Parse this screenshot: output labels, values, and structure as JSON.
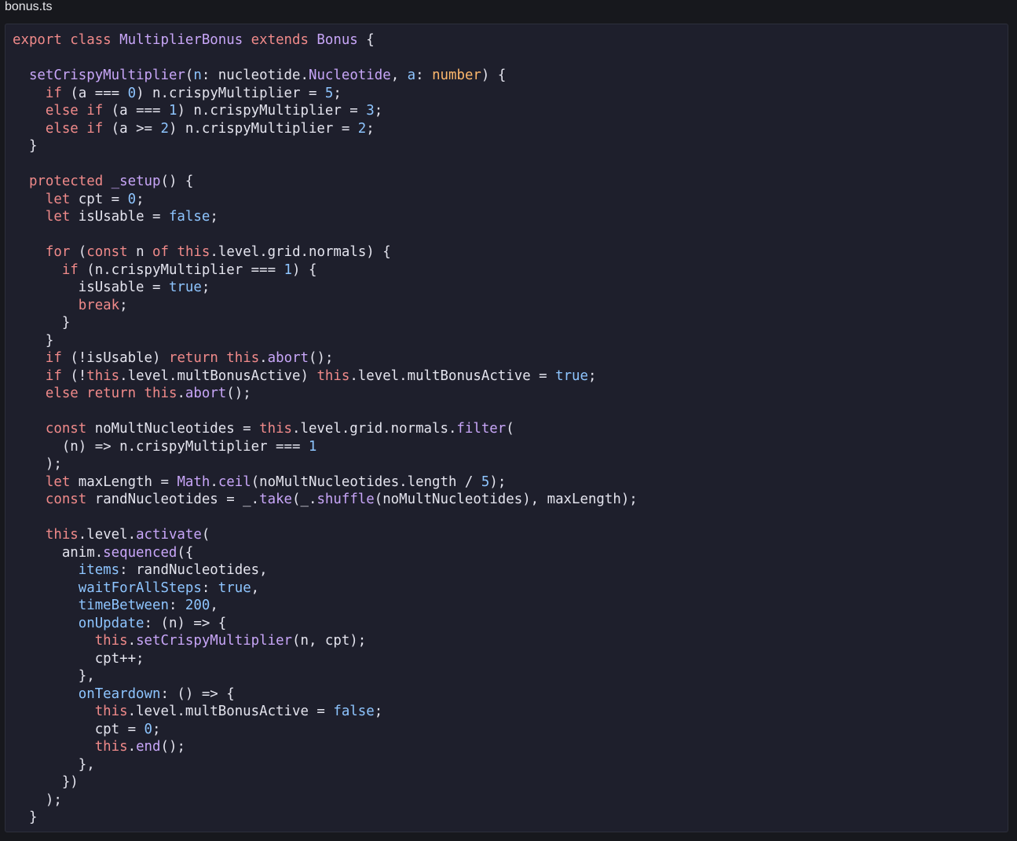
{
  "file_tab": {
    "title": "bonus.ts"
  },
  "colors": {
    "keyword": "#f08a8a",
    "function": "#c8a6f8",
    "property": "#8ec5ff",
    "type": "#ffb86c",
    "text": "#e4e4ee",
    "background": "#1e1f2c"
  },
  "code_lines": [
    [
      [
        "k",
        "export class "
      ],
      [
        "f",
        "MultiplierBonus"
      ],
      [
        "k",
        " extends "
      ],
      [
        "f",
        "Bonus"
      ],
      [
        "t",
        " {"
      ]
    ],
    [],
    [
      [
        "t",
        "  "
      ],
      [
        "f",
        "setCrispyMultiplier"
      ],
      [
        "t",
        "("
      ],
      [
        "p",
        "n"
      ],
      [
        "t",
        ": nucleotide."
      ],
      [
        "f",
        "Nucleotide"
      ],
      [
        "t",
        ", "
      ],
      [
        "p",
        "a"
      ],
      [
        "t",
        ": "
      ],
      [
        "o",
        "number"
      ],
      [
        "t",
        ") {"
      ]
    ],
    [
      [
        "t",
        "    "
      ],
      [
        "k",
        "if"
      ],
      [
        "t",
        " (a === "
      ],
      [
        "p",
        "0"
      ],
      [
        "t",
        ") n.crispyMultiplier = "
      ],
      [
        "p",
        "5"
      ],
      [
        "t",
        ";"
      ]
    ],
    [
      [
        "t",
        "    "
      ],
      [
        "k",
        "else if"
      ],
      [
        "t",
        " (a === "
      ],
      [
        "p",
        "1"
      ],
      [
        "t",
        ") n.crispyMultiplier = "
      ],
      [
        "p",
        "3"
      ],
      [
        "t",
        ";"
      ]
    ],
    [
      [
        "t",
        "    "
      ],
      [
        "k",
        "else if"
      ],
      [
        "t",
        " (a >= "
      ],
      [
        "p",
        "2"
      ],
      [
        "t",
        ") n.crispyMultiplier = "
      ],
      [
        "p",
        "2"
      ],
      [
        "t",
        ";"
      ]
    ],
    [
      [
        "t",
        "  }"
      ]
    ],
    [],
    [
      [
        "t",
        "  "
      ],
      [
        "k",
        "protected"
      ],
      [
        "t",
        " "
      ],
      [
        "f",
        "_setup"
      ],
      [
        "t",
        "() {"
      ]
    ],
    [
      [
        "t",
        "    "
      ],
      [
        "k",
        "let"
      ],
      [
        "t",
        " cpt = "
      ],
      [
        "p",
        "0"
      ],
      [
        "t",
        ";"
      ]
    ],
    [
      [
        "t",
        "    "
      ],
      [
        "k",
        "let"
      ],
      [
        "t",
        " isUsable = "
      ],
      [
        "p",
        "false"
      ],
      [
        "t",
        ";"
      ]
    ],
    [],
    [
      [
        "t",
        "    "
      ],
      [
        "k",
        "for"
      ],
      [
        "t",
        " ("
      ],
      [
        "k",
        "const"
      ],
      [
        "t",
        " n "
      ],
      [
        "k",
        "of"
      ],
      [
        "t",
        " "
      ],
      [
        "k",
        "this"
      ],
      [
        "t",
        ".level.grid.normals) {"
      ]
    ],
    [
      [
        "t",
        "      "
      ],
      [
        "k",
        "if"
      ],
      [
        "t",
        " (n.crispyMultiplier === "
      ],
      [
        "p",
        "1"
      ],
      [
        "t",
        ") {"
      ]
    ],
    [
      [
        "t",
        "        isUsable = "
      ],
      [
        "p",
        "true"
      ],
      [
        "t",
        ";"
      ]
    ],
    [
      [
        "t",
        "        "
      ],
      [
        "k",
        "break"
      ],
      [
        "t",
        ";"
      ]
    ],
    [
      [
        "t",
        "      }"
      ]
    ],
    [
      [
        "t",
        "    }"
      ]
    ],
    [
      [
        "t",
        "    "
      ],
      [
        "k",
        "if"
      ],
      [
        "t",
        " (!isUsable) "
      ],
      [
        "k",
        "return"
      ],
      [
        "t",
        " "
      ],
      [
        "k",
        "this"
      ],
      [
        "t",
        "."
      ],
      [
        "f",
        "abort"
      ],
      [
        "t",
        "();"
      ]
    ],
    [
      [
        "t",
        "    "
      ],
      [
        "k",
        "if"
      ],
      [
        "t",
        " (!"
      ],
      [
        "k",
        "this"
      ],
      [
        "t",
        ".level.multBonusActive) "
      ],
      [
        "k",
        "this"
      ],
      [
        "t",
        ".level.multBonusActive = "
      ],
      [
        "p",
        "true"
      ],
      [
        "t",
        ";"
      ]
    ],
    [
      [
        "t",
        "    "
      ],
      [
        "k",
        "else return"
      ],
      [
        "t",
        " "
      ],
      [
        "k",
        "this"
      ],
      [
        "t",
        "."
      ],
      [
        "f",
        "abort"
      ],
      [
        "t",
        "();"
      ]
    ],
    [],
    [
      [
        "t",
        "    "
      ],
      [
        "k",
        "const"
      ],
      [
        "t",
        " noMultNucleotides = "
      ],
      [
        "k",
        "this"
      ],
      [
        "t",
        ".level.grid.normals."
      ],
      [
        "f",
        "filter"
      ],
      [
        "t",
        "("
      ]
    ],
    [
      [
        "t",
        "      (n) => n.crispyMultiplier === "
      ],
      [
        "p",
        "1"
      ]
    ],
    [
      [
        "t",
        "    );"
      ]
    ],
    [
      [
        "t",
        "    "
      ],
      [
        "k",
        "let"
      ],
      [
        "t",
        " maxLength = "
      ],
      [
        "f",
        "Math"
      ],
      [
        "t",
        "."
      ],
      [
        "f",
        "ceil"
      ],
      [
        "t",
        "(noMultNucleotides.length / "
      ],
      [
        "p",
        "5"
      ],
      [
        "t",
        ");"
      ]
    ],
    [
      [
        "t",
        "    "
      ],
      [
        "k",
        "const"
      ],
      [
        "t",
        " randNucleotides = _."
      ],
      [
        "f",
        "take"
      ],
      [
        "t",
        "(_."
      ],
      [
        "f",
        "shuffle"
      ],
      [
        "t",
        "(noMultNucleotides), maxLength);"
      ]
    ],
    [],
    [
      [
        "t",
        "    "
      ],
      [
        "k",
        "this"
      ],
      [
        "t",
        ".level."
      ],
      [
        "f",
        "activate"
      ],
      [
        "t",
        "("
      ]
    ],
    [
      [
        "t",
        "      anim."
      ],
      [
        "f",
        "sequenced"
      ],
      [
        "t",
        "({"
      ]
    ],
    [
      [
        "t",
        "        "
      ],
      [
        "p",
        "items"
      ],
      [
        "t",
        ": randNucleotides,"
      ]
    ],
    [
      [
        "t",
        "        "
      ],
      [
        "p",
        "waitForAllSteps"
      ],
      [
        "t",
        ": "
      ],
      [
        "p",
        "true"
      ],
      [
        "t",
        ","
      ]
    ],
    [
      [
        "t",
        "        "
      ],
      [
        "p",
        "timeBetween"
      ],
      [
        "t",
        ": "
      ],
      [
        "p",
        "200"
      ],
      [
        "t",
        ","
      ]
    ],
    [
      [
        "t",
        "        "
      ],
      [
        "p",
        "onUpdate"
      ],
      [
        "t",
        ": (n) => {"
      ]
    ],
    [
      [
        "t",
        "          "
      ],
      [
        "k",
        "this"
      ],
      [
        "t",
        "."
      ],
      [
        "f",
        "setCrispyMultiplier"
      ],
      [
        "t",
        "(n, cpt);"
      ]
    ],
    [
      [
        "t",
        "          cpt++;"
      ]
    ],
    [
      [
        "t",
        "        },"
      ]
    ],
    [
      [
        "t",
        "        "
      ],
      [
        "p",
        "onTeardown"
      ],
      [
        "t",
        ": () => {"
      ]
    ],
    [
      [
        "t",
        "          "
      ],
      [
        "k",
        "this"
      ],
      [
        "t",
        ".level.multBonusActive = "
      ],
      [
        "p",
        "false"
      ],
      [
        "t",
        ";"
      ]
    ],
    [
      [
        "t",
        "          cpt = "
      ],
      [
        "p",
        "0"
      ],
      [
        "t",
        ";"
      ]
    ],
    [
      [
        "t",
        "          "
      ],
      [
        "k",
        "this"
      ],
      [
        "t",
        "."
      ],
      [
        "f",
        "end"
      ],
      [
        "t",
        "();"
      ]
    ],
    [
      [
        "t",
        "        },"
      ]
    ],
    [
      [
        "t",
        "      })"
      ]
    ],
    [
      [
        "t",
        "    );"
      ]
    ],
    [
      [
        "t",
        "  }"
      ]
    ]
  ]
}
